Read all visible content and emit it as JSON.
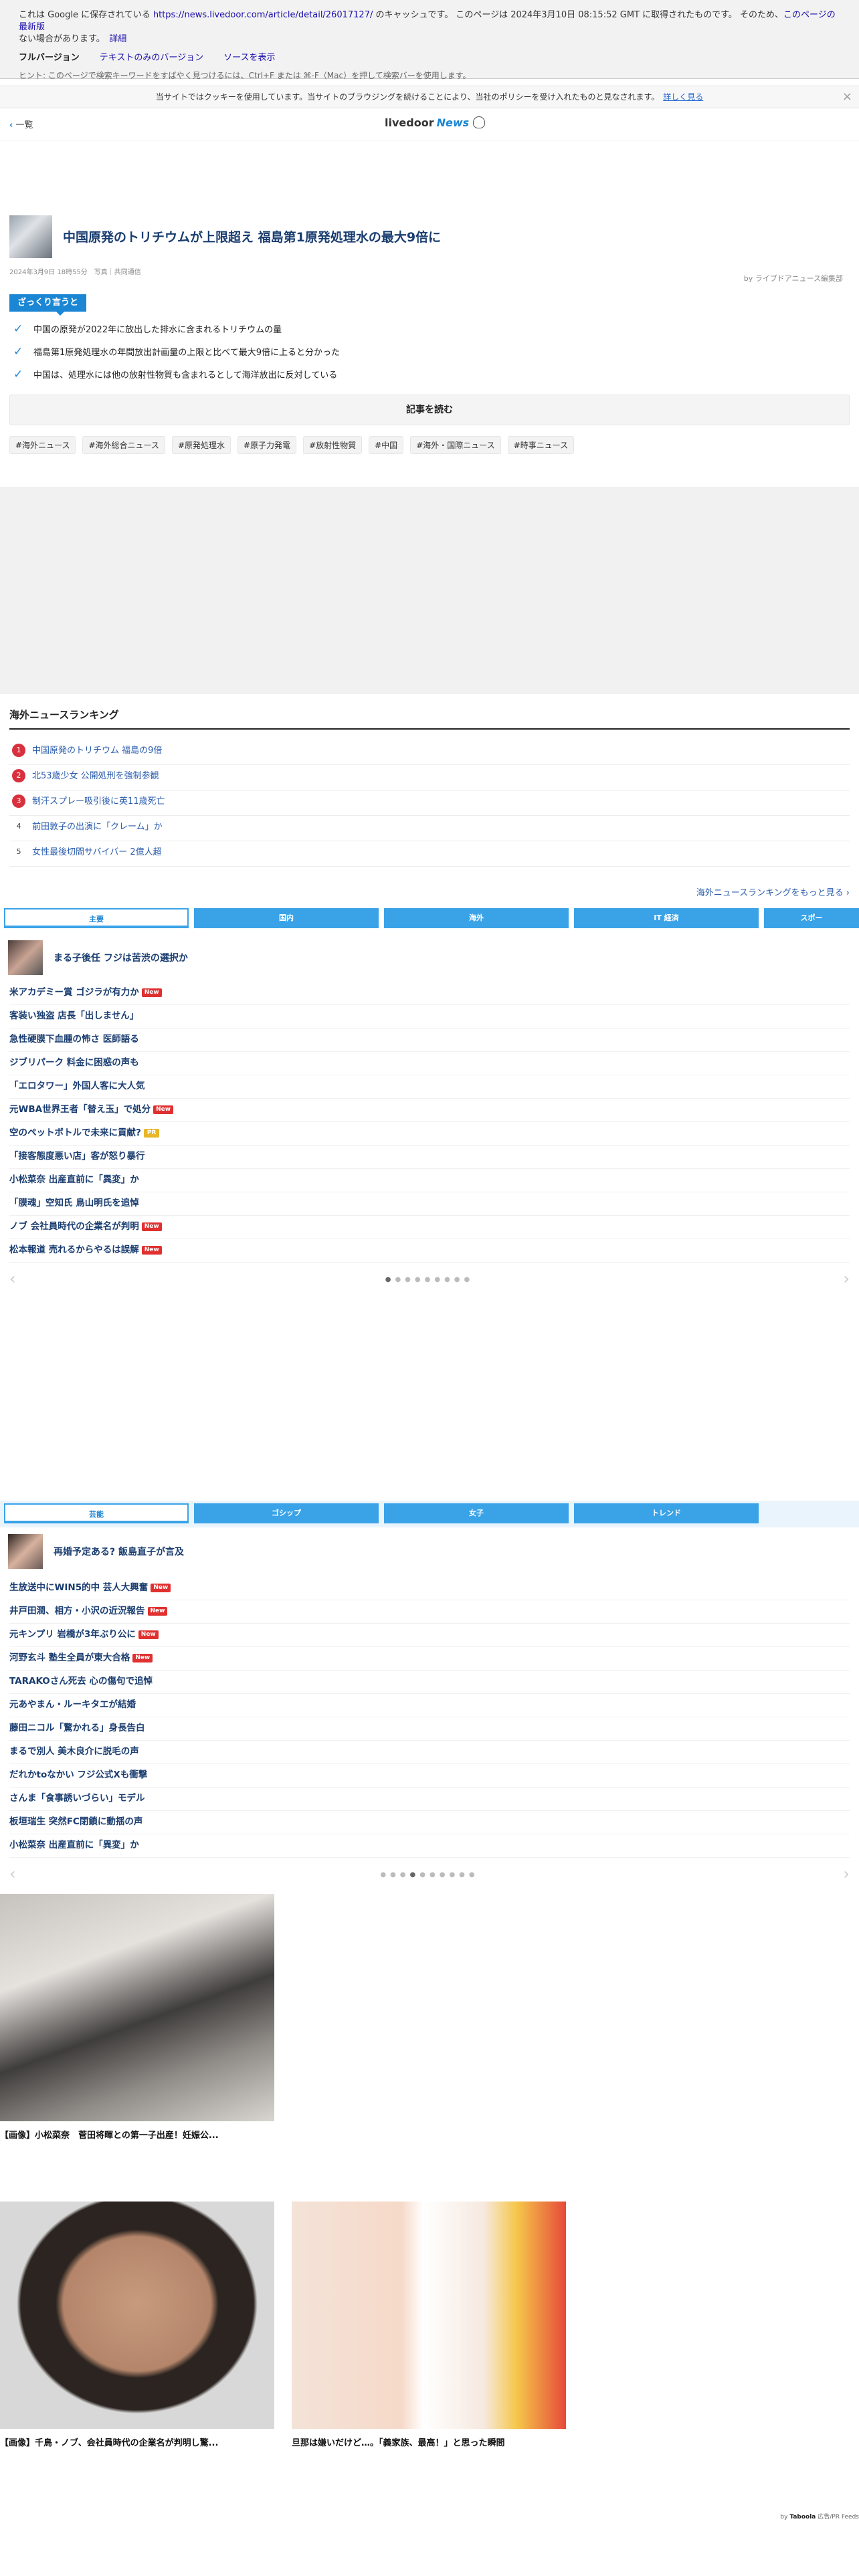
{
  "cache_banner": {
    "line1_prefix": "これは Google に保存されている ",
    "line1_url": "https://news.livedoor.com/article/detail/26017127/",
    "line1_suffix": " のキャッシュです。 このページは 2024年3月10日 08:15:52 GMT に取得されたものです。 そのため、",
    "line1_link": "このページの最新版",
    "line2_text": "ない場合があります。",
    "line2_link": "詳細",
    "full_version": "フルバージョン",
    "text_only": "テキストのみのバージョン",
    "view_source": "ソースを表示",
    "hint": "ヒント: このページで検索キーワードをすばやく見つけるには、Ctrl+F または ⌘-F（Mac）を押して検索バーを使用します。"
  },
  "cookie": {
    "text": "当サイトではクッキーを使用しています。当サイトのブラウジングを続けることにより、当社のポリシーを受け入れたものと見なされます。",
    "more": "詳しく見る"
  },
  "header": {
    "back": "一覧",
    "logo": "livedoor",
    "logo_news": "News"
  },
  "article": {
    "title": "中国原発のトリチウムが上限超え 福島第1原発処理水の最大9倍に",
    "meta": "2024年3月9日 18時55分　写真｜共同通信",
    "byline": "by ライブドアニュース編集部",
    "summary_label": "ざっくり言うと",
    "points": [
      "中国の原発が2022年に放出した排水に含まれるトリチウムの量",
      "福島第1原発処理水の年間放出計画量の上限と比べて最大9倍に上ると分かった",
      "中国は、処理水には他の放射性物質も含まれるとして海洋放出に反対している"
    ],
    "read_button": "記事を読む",
    "tags": [
      "#海外ニュース",
      "#海外総合ニュース",
      "#原発処理水",
      "#原子力発電",
      "#放射性物質",
      "#中国",
      "#海外・国際ニュース",
      "#時事ニュース"
    ]
  },
  "ranking": {
    "title": "海外ニュースランキング",
    "items": [
      {
        "num": "1",
        "text": "中国原発のトリチウム 福島の9倍"
      },
      {
        "num": "2",
        "text": "北53歳少女 公開処刑を強制参観"
      },
      {
        "num": "3",
        "text": "制汗スプレー吸引後に英11歳死亡"
      },
      {
        "num": "4",
        "text": "前田敦子の出演に「クレーム」か"
      },
      {
        "num": "5",
        "text": "女性最後切問サバイバー 2億人超"
      }
    ],
    "more": "海外ニュースランキングをもっと見る ›"
  },
  "news_block1": {
    "tabs": [
      "主要",
      "国内",
      "海外",
      "IT 経済",
      "スポー"
    ],
    "lead": "まる子後任 フジは苦渋の選択か",
    "headlines": [
      {
        "text": "米アカデミー賞 ゴジラが有力か",
        "badge": "New"
      },
      {
        "text": "客装い独盗 店長「出しません」",
        "badge": ""
      },
      {
        "text": "急性硬膜下血腫の怖さ 医師語る",
        "badge": ""
      },
      {
        "text": "ジブリパーク 料金に困惑の声も",
        "badge": ""
      },
      {
        "text": "「エロタワー」外国人客に大人気",
        "badge": ""
      },
      {
        "text": "元WBA世界王者「替え玉」で処分",
        "badge": "New"
      },
      {
        "text": "空のペットボトルで未来に貢献?",
        "badge": "PR"
      },
      {
        "text": "「接客態度悪い店」客が怒り暴行",
        "badge": ""
      },
      {
        "text": "小松菜奈 出産直前に「異変」か",
        "badge": ""
      },
      {
        "text": "「膜魂」空知氏 鳥山明氏を追悼",
        "badge": ""
      },
      {
        "text": "ノブ 会社員時代の企業名が判明",
        "badge": "New"
      },
      {
        "text": "松本報道 売れるからやるは誤解",
        "badge": "New"
      }
    ]
  },
  "news_block2": {
    "tabs": [
      "芸能",
      "ゴシップ",
      "女子",
      "トレンド"
    ],
    "lead": "再婚予定ある? 飯島直子が言及",
    "headlines": [
      {
        "text": "生放送中にWIN5的中 芸人大興奮",
        "badge": "New"
      },
      {
        "text": "井戸田潤、相方・小沢の近況報告",
        "badge": "New"
      },
      {
        "text": "元キンプリ 岩橋が3年ぶり公に",
        "badge": "New"
      },
      {
        "text": "河野玄斗 塾生全員が東大合格",
        "badge": "New"
      },
      {
        "text": "TARAKOさん死去 心の傷句で追悼",
        "badge": ""
      },
      {
        "text": "元あやまん・ルーキタエが結婚",
        "badge": ""
      },
      {
        "text": "藤田ニコル「驚かれる」身長告白",
        "badge": ""
      },
      {
        "text": "まるで別人 美木良介に脱毛の声",
        "badge": ""
      },
      {
        "text": "だれかtoなかい フジ公式Xも衝撃",
        "badge": ""
      },
      {
        "text": "さんま「食事誘いづらい」モデル",
        "badge": ""
      },
      {
        "text": "板垣瑞生 突然FC閉鎖に動揺の声",
        "badge": ""
      },
      {
        "text": "小松菜奈 出産直前に「異変」か",
        "badge": ""
      }
    ]
  },
  "cards": [
    {
      "caption": "【画像】小松菜奈　菅田将暉との第一子出産！妊娠公..."
    },
    {
      "caption": "【画像】千鳥・ノブ、会社員時代の企業名が判明し驚..."
    },
    {
      "caption": "旦那は嫌いだけど…。「義家族、最高！」と思った瞬間"
    }
  ],
  "taboola": {
    "by": "by",
    "name": "Taboola",
    "suffix": "広告/PR Feeds"
  }
}
